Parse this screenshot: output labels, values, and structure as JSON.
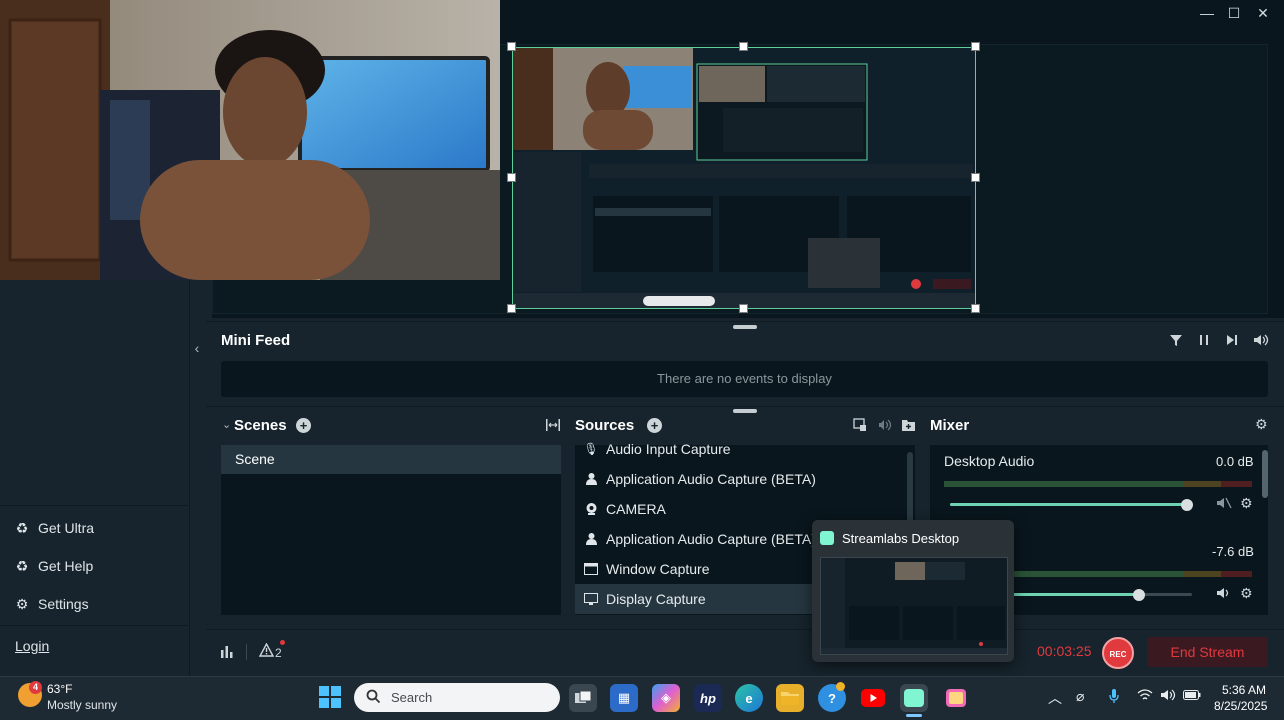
{
  "window": {
    "minimize": "—",
    "maximize": "☐",
    "close": "✕"
  },
  "sidebar": {
    "get_ultra": "Get Ultra",
    "get_help": "Get Help",
    "settings": "Settings",
    "login": "Login"
  },
  "mini_feed": {
    "title": "Mini Feed",
    "empty_text": "There are no events to display"
  },
  "scenes": {
    "title": "Scenes",
    "items": [
      "Scene"
    ]
  },
  "sources": {
    "title": "Sources",
    "items": [
      {
        "label": "Audio Input Capture",
        "icon": "microphone-icon"
      },
      {
        "label": "Application Audio Capture (BETA)",
        "icon": "person-icon"
      },
      {
        "label": "CAMERA",
        "icon": "webcam-icon"
      },
      {
        "label": "Application Audio Capture (BETA)",
        "icon": "person-icon"
      },
      {
        "label": "Window Capture",
        "icon": "window-icon"
      },
      {
        "label": "Display Capture",
        "icon": "monitor-icon"
      }
    ]
  },
  "mixer": {
    "title": "Mixer",
    "channels": [
      {
        "name": "Desktop Audio",
        "db": "0.0 dB",
        "level": 0.98
      },
      {
        "name": "",
        "db": "-7.6 dB",
        "level": 0.78
      }
    ]
  },
  "footer": {
    "alert_count": "2",
    "timer": "00:03:25",
    "rec_label": "REC",
    "end_stream": "End Stream"
  },
  "popup": {
    "title": "Streamlabs Desktop"
  },
  "taskbar": {
    "weather_temp": "63°F",
    "weather_desc": "Mostly sunny",
    "weather_badge": "4",
    "search_placeholder": "Search",
    "time": "5:36 AM",
    "date": "8/25/2025"
  },
  "colors": {
    "accent": "#5ecf9a",
    "record_red": "#e0393e",
    "panel_bg": "#09161d",
    "app_bg": "#17242d"
  }
}
